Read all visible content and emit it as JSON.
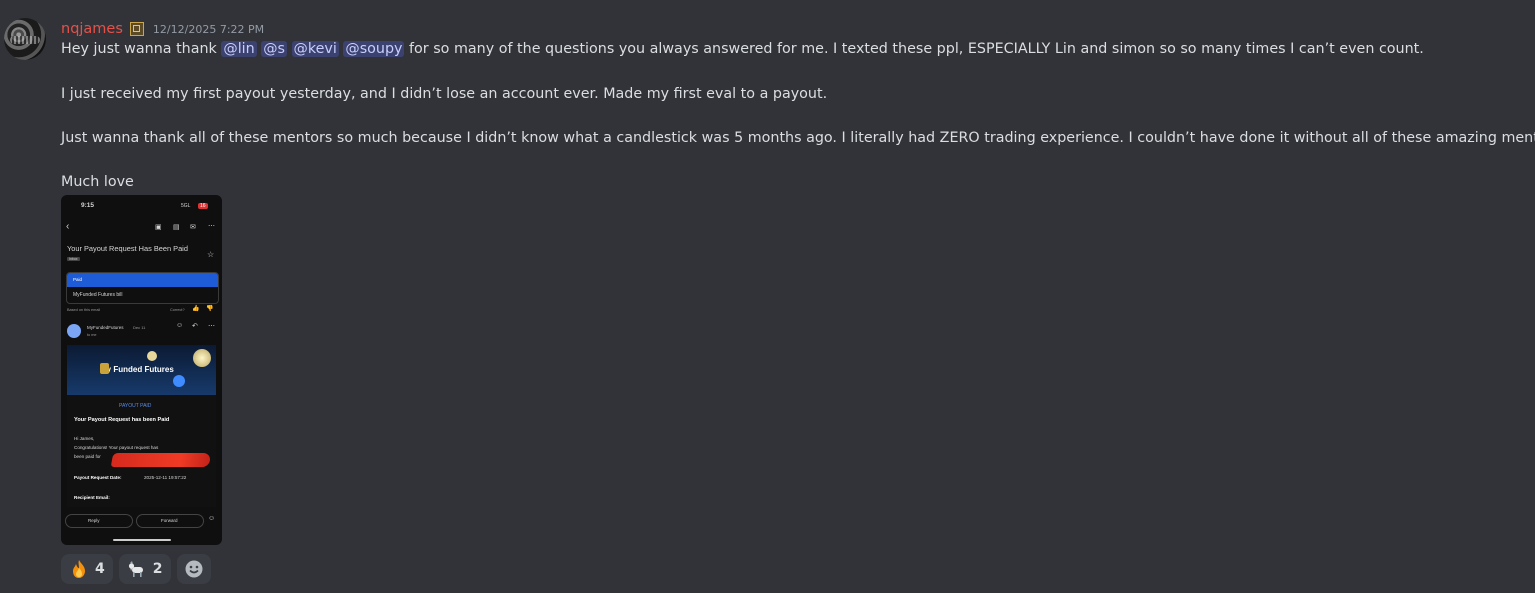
{
  "message": {
    "username": "nqjames",
    "timestamp": "12/12/2025 7:22 PM",
    "line1_before": "Hey just wanna thank ",
    "mentions": [
      "@lin",
      "@s",
      "@kevi",
      "@soupy"
    ],
    "line1_after": " for so many of the questions you always answered for me. I texted these ppl, ESPECIALLY Lin and simon so so many times I can’t even count.",
    "line2": "I just received my first payout yesterday, and I didn’t lose an account ever. Made my first eval to a payout.",
    "line3": "Just wanna thank all of these mentors so much because I didn’t know what a candlestick was 5 months ago. I literally had ZERO trading experience. I couldn’t have done it without all of these amazing mentors.",
    "line4": "Much love"
  },
  "attachment": {
    "status_time": "9:15",
    "status_net": "5GL",
    "status_batt": "16",
    "email_subject": "Your Payout Request Has Been Paid",
    "inbox_label": "Inbox",
    "summary_chip": "Paid",
    "summary_row": "MyFunded Futures bill",
    "based_on": "Based on this email",
    "correct_q": "Correct?",
    "sender": "MyFundedFutures",
    "sender_date": "Dec 11",
    "to_me": "to me",
    "brand": "My Funded Futures",
    "payout_paid": "PAYOUT PAID",
    "heading": "Your Payout Request has been Paid",
    "greeting": "Hi James,",
    "body1": "Congratulations! Your payout request has",
    "body2": "been paid for",
    "req_date_label": "Payout Request Date:",
    "req_date_value": "2025-12-11 19:57:22",
    "recipient_label": "Recipient Email:",
    "reply": "Reply",
    "forward": "Forward"
  },
  "reactions": [
    {
      "emoji": "fire-emoji",
      "count": "4"
    },
    {
      "emoji": "goat-emoji",
      "count": "2"
    }
  ],
  "colors": {
    "background": "#313338",
    "username": "#e5514a",
    "mention_bg": "#3c4270",
    "mention_fg": "#c9cdfb",
    "reaction_bg": "#3b3d44"
  }
}
